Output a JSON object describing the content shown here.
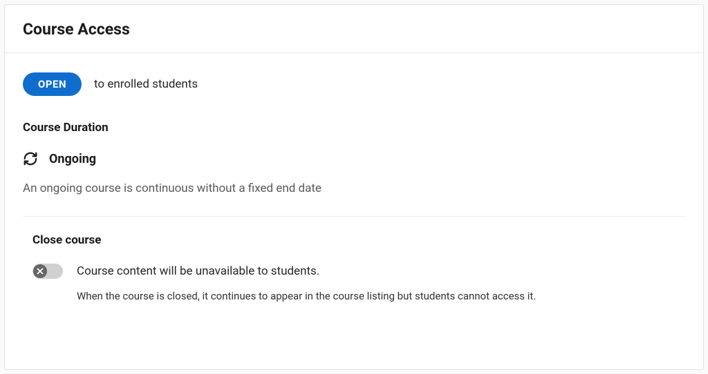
{
  "header": {
    "title": "Course Access"
  },
  "status": {
    "pill_label": "OPEN",
    "text": "to enrolled students"
  },
  "duration": {
    "section_label": "Course Duration",
    "value": "Ongoing",
    "description": "An ongoing course is continuous without a fixed end date"
  },
  "close_course": {
    "title": "Close course",
    "toggle_label": "Course content will be unavailable to students.",
    "description": "When the course is closed, it continues to appear in the course listing but students cannot access it.",
    "toggle_on": false
  }
}
